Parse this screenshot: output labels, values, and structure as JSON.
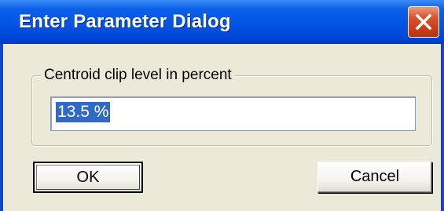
{
  "window": {
    "title": "Enter Parameter Dialog",
    "close_icon": "close-icon"
  },
  "group": {
    "label": "Centroid clip level in percent"
  },
  "field": {
    "value": "13.5 %"
  },
  "buttons": {
    "ok_label": "OK",
    "cancel_label": "Cancel"
  },
  "colors": {
    "titlebar": "#0454e3",
    "close_button": "#d8542c",
    "dialog_face": "#ece9d8",
    "selection": "#316ac5"
  }
}
